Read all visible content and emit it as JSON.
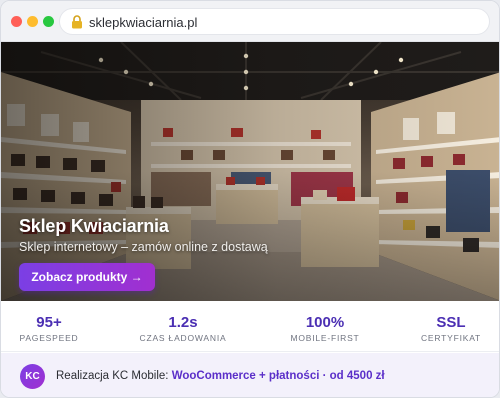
{
  "browser": {
    "url": "sklepkwiaciarnia.pl",
    "controls": [
      "close",
      "minimize",
      "maximize"
    ],
    "lock_icon": "lock-icon"
  },
  "hero": {
    "title": "Sklep Kwiaciarnia",
    "subtitle": "Sklep internetowy – zamów online z dostawą",
    "cta_label": "Zobacz produkty →",
    "image": "store-interior-photo"
  },
  "stats": [
    {
      "value": "95+",
      "label": "PAGESPEED"
    },
    {
      "value": "1.2s",
      "label": "CZAS ŁADOWANIA"
    },
    {
      "value": "100%",
      "label": "MOBILE-FIRST"
    },
    {
      "value": "SSL",
      "label": "CERTYFIKAT"
    }
  ],
  "footer": {
    "avatar_initials": "KC",
    "text_prefix": "Realizacja KC Mobile: ",
    "link_text": "WooCommerce + płatności · od 4500 zł"
  },
  "colors": {
    "accent": "#7b3fe4",
    "accent2": "#a12fd0",
    "stat_value": "#4b2fb3"
  }
}
